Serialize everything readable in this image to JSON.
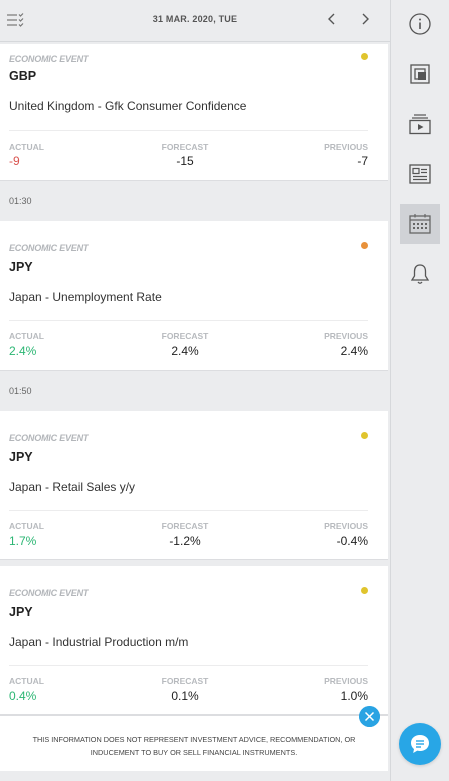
{
  "header": {
    "date": "31 MAR. 2020, TUE"
  },
  "labels": {
    "actual": "ACTUAL",
    "forecast": "FORECAST",
    "previous": "PREVIOUS"
  },
  "colors": {
    "negative": "#d9534f",
    "positive": "#2bb673",
    "impact_medium": "#e0c42d",
    "impact_high": "#e8913a",
    "accent": "#28a6e6"
  },
  "events": [
    {
      "type": "ECONOMIC EVENT",
      "currency": "GBP",
      "title": "United Kingdom - Gfk Consumer Confidence",
      "actual": "-9",
      "forecast": "-15",
      "previous": "-7",
      "impact_color": "#e0c42d"
    },
    {
      "type": "ECONOMIC EVENT",
      "currency": "JPY",
      "title": "Japan - Unemployment Rate",
      "actual": "2.4%",
      "forecast": "2.4%",
      "previous": "2.4%",
      "impact_color": "#e8913a"
    },
    {
      "type": "ECONOMIC EVENT",
      "currency": "JPY",
      "title": "Japan - Retail Sales y/y",
      "actual": "1.7%",
      "forecast": "-1.2%",
      "previous": "-0.4%",
      "impact_color": "#e0c42d"
    },
    {
      "type": "ECONOMIC EVENT",
      "currency": "JPY",
      "title": "Japan - Industrial Production m/m",
      "actual": "0.4%",
      "forecast": "0.1%",
      "previous": "1.0%",
      "impact_color": "#e0c42d"
    }
  ],
  "times": [
    "01:30",
    "01:50"
  ],
  "disclaimer": "THIS INFORMATION DOES NOT REPRESENT INVESTMENT ADVICE, RECOMMENDATION, OR INDUCEMENT TO BUY OR SELL FINANCIAL INSTRUMENTS.",
  "sidebar": {
    "icons": [
      "info-icon",
      "copy-icon",
      "video-icon",
      "news-icon",
      "calendar-icon",
      "bell-icon"
    ],
    "active": "calendar-icon"
  }
}
